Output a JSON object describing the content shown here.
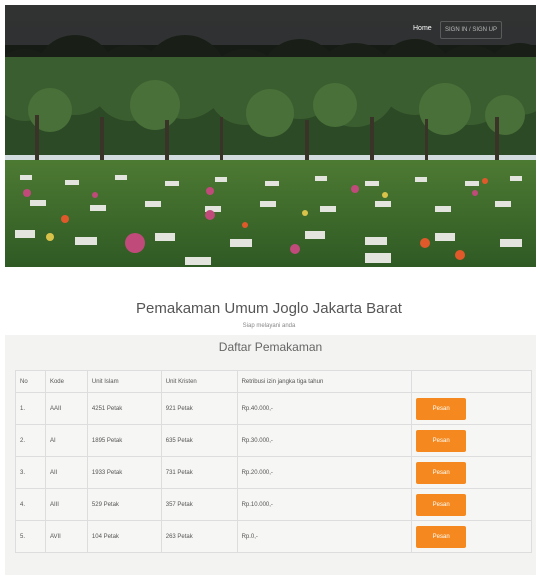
{
  "nav": {
    "home_label": "Home",
    "signin_label": "SIGN IN / SIGN UP"
  },
  "site": {
    "title": "Pemakaman Umum Joglo Jakarta Barat",
    "subtitle": "Siap melayani anda"
  },
  "panel": {
    "title": "Daftar Pemakaman"
  },
  "table": {
    "headers": [
      "No",
      "Kode",
      "Unit Islam",
      "Unit Kristen",
      "Retribusi izin jangka tiga tahun",
      ""
    ],
    "rows": [
      {
        "no": "1.",
        "kode": "AAII",
        "islam": "4251 Petak",
        "kristen": "921 Petak",
        "retribusi": "Rp.40.000,-",
        "action": "Pesan"
      },
      {
        "no": "2.",
        "kode": "AI",
        "islam": "1895 Petak",
        "kristen": "635 Petak",
        "retribusi": "Rp.30.000,-",
        "action": "Pesan"
      },
      {
        "no": "3.",
        "kode": "AII",
        "islam": "1933 Petak",
        "kristen": "731 Petak",
        "retribusi": "Rp.20.000,-",
        "action": "Pesan"
      },
      {
        "no": "4.",
        "kode": "AIII",
        "islam": "529 Petak",
        "kristen": "357 Petak",
        "retribusi": "Rp.10.000,-",
        "action": "Pesan"
      },
      {
        "no": "5.",
        "kode": "AVII",
        "islam": "104 Petak",
        "kristen": "263 Petak",
        "retribusi": "Rp.0,-",
        "action": "Pesan"
      }
    ]
  },
  "colors": {
    "accent": "#f5891f",
    "navbar": "#141414",
    "panel": "#f3f3f1"
  }
}
